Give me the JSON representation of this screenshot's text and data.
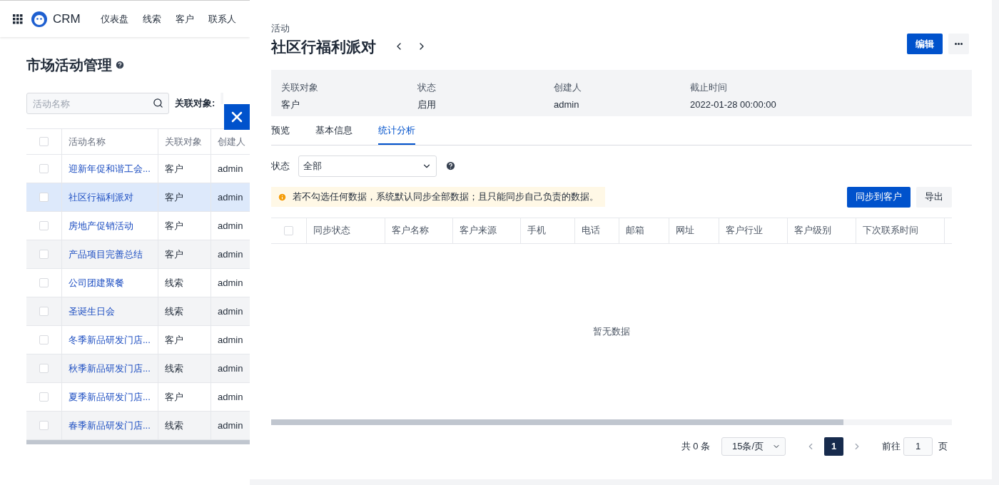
{
  "nav": {
    "brand": "CRM",
    "items": [
      {
        "label": "仪表盘",
        "selected": false
      },
      {
        "label": "线索",
        "selected": false
      },
      {
        "label": "客户",
        "selected": false
      },
      {
        "label": "联系人",
        "selected": false
      }
    ]
  },
  "page": {
    "title": "市场活动管理",
    "search": {
      "placeholder": "活动名称"
    },
    "filter": {
      "label": "关联对象:"
    },
    "select_all_checked": false,
    "columns": [
      "活动名称",
      "关联对象",
      "创建人"
    ],
    "rows": [
      {
        "name": "迎新年促和谐工会...",
        "object": "客户",
        "creator": "admin",
        "selected": false
      },
      {
        "name": "社区行福利派对",
        "object": "客户",
        "creator": "admin",
        "selected": true
      },
      {
        "name": "房地产促销活动",
        "object": "客户",
        "creator": "admin",
        "selected": false
      },
      {
        "name": "产品项目完善总结",
        "object": "客户",
        "creator": "admin",
        "selected": false
      },
      {
        "name": "公司团建聚餐",
        "object": "线索",
        "creator": "admin",
        "selected": false
      },
      {
        "name": "圣诞生日会",
        "object": "线索",
        "creator": "admin",
        "selected": false
      },
      {
        "name": "冬季新品研发门店...",
        "object": "客户",
        "creator": "admin",
        "selected": false
      },
      {
        "name": "秋季新品研发门店...",
        "object": "线索",
        "creator": "admin",
        "selected": false
      },
      {
        "name": "夏季新品研发门店...",
        "object": "客户",
        "creator": "admin",
        "selected": false
      },
      {
        "name": "春季新品研发门店...",
        "object": "线索",
        "creator": "admin",
        "selected": false
      }
    ]
  },
  "drawer": {
    "kicker": "活动",
    "title": "社区行福利派对",
    "edit_button": "编辑",
    "summary": [
      {
        "label": "关联对象",
        "value": "客户"
      },
      {
        "label": "状态",
        "value": "启用"
      },
      {
        "label": "创建人",
        "value": "admin"
      },
      {
        "label": "截止时间",
        "value": "2022-01-28 00:00:00"
      }
    ],
    "tabs": [
      {
        "label": "预览",
        "selected": false
      },
      {
        "label": "基本信息",
        "selected": false
      },
      {
        "label": "统计分析",
        "selected": true
      }
    ],
    "status_filter": {
      "label": "状态",
      "value": "全部"
    },
    "notice": "若不勾选任何数据，系统默认同步全部数据；且只能同步自己负责的数据。",
    "sync_button": "同步到客户",
    "export_button": "导出",
    "columns": [
      "同步状态",
      "客户名称",
      "客户来源",
      "手机",
      "电话",
      "邮箱",
      "网址",
      "客户行业",
      "客户级别",
      "下次联系时间"
    ],
    "select_all_checked": false,
    "empty": "暂无数据",
    "pagination": {
      "total": "共 0 条",
      "page_size": "15条/页",
      "pages": [
        {
          "label": "1",
          "selected": true
        }
      ],
      "goto_label": "前往",
      "goto_value": "1",
      "goto_suffix": "页"
    }
  }
}
